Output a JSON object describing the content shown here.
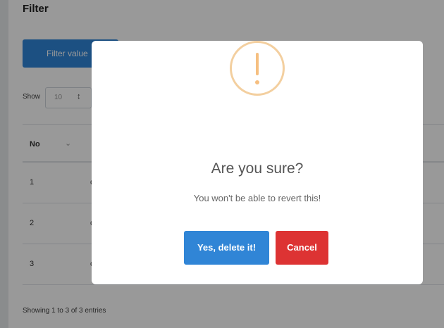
{
  "page": {
    "filter_title": "Filter",
    "filter_button_label": "Filter value",
    "show_label": "Show",
    "show_select_value": "10",
    "table": {
      "header_no": "No",
      "rows": [
        {
          "no": "1",
          "col2": "c"
        },
        {
          "no": "2",
          "col2": "c"
        },
        {
          "no": "3",
          "col2": "c"
        }
      ]
    },
    "footer_info": "Showing 1 to 3 of 3 entries"
  },
  "modal": {
    "icon": "warning-icon",
    "title": "Are you sure?",
    "text": "You won't be able to revert this!",
    "confirm_label": "Yes, delete it!",
    "cancel_label": "Cancel",
    "colors": {
      "confirm": "#3085d6",
      "cancel": "#dd3333",
      "warning": "#f8bb86"
    }
  }
}
